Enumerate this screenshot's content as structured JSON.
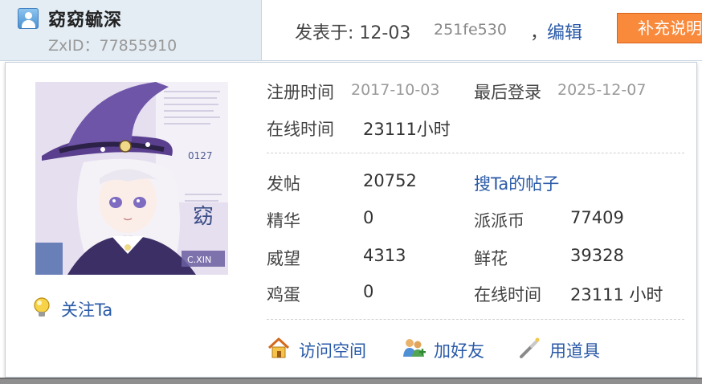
{
  "author": {
    "name": "窈窈毓深",
    "zxid": "ZxID：77855910"
  },
  "post_header": {
    "posted": "发表于: 12-03",
    "hash": "251fe530",
    "comma": "，",
    "edit": "编辑",
    "supplement": "补充说明"
  },
  "profile": {
    "register_label": "注册时间",
    "register_value": "2017-10-03",
    "lastlogin_label": "最后登录",
    "lastlogin_value": "2025-12-07",
    "online_label": "在线时间",
    "online_value": "23111小时",
    "follow": "关注Ta"
  },
  "stats": {
    "posts_label": "发帖",
    "posts_value": "20752",
    "search_posts": "搜Ta的帖子",
    "digest_label": "精华",
    "digest_value": "0",
    "coins_label": "派派币",
    "coins_value": "77409",
    "prestige_label": "威望",
    "prestige_value": "4313",
    "flowers_label": "鲜花",
    "flowers_value": "39328",
    "eggs_label": "鸡蛋",
    "eggs_value": "0",
    "online2_label": "在线时间",
    "online2_value": "23111 小时"
  },
  "actions": {
    "visit": "访问空间",
    "add_friend": "加好友",
    "use_item": "用道具"
  },
  "avatar_text": {
    "number": "0127",
    "glyph": "窈",
    "signature": "C.XIN"
  },
  "icons": {
    "user": "user-icon",
    "follow": "lightbulb-icon",
    "visit": "home-icon",
    "friend": "people-icon",
    "item": "wand-icon"
  }
}
